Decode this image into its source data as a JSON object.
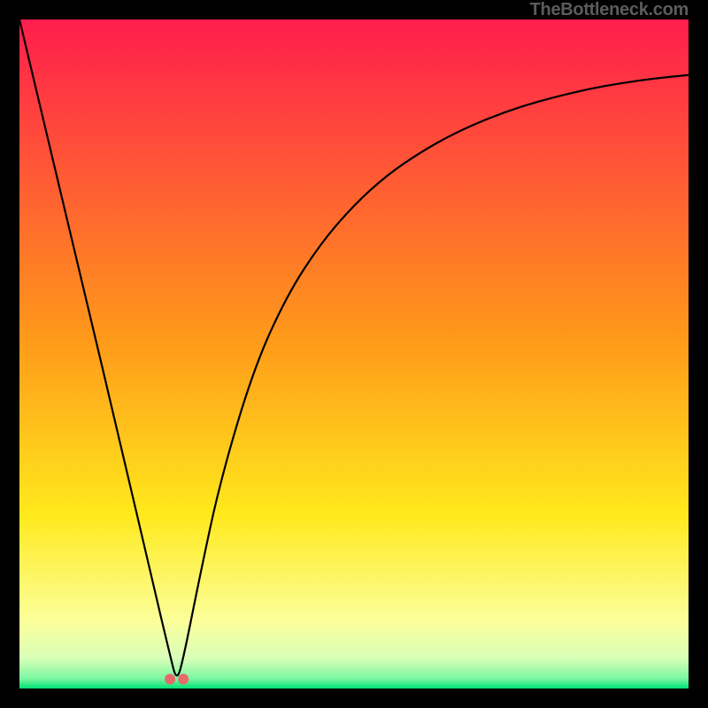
{
  "watermark": "TheBottleneck.com",
  "gradient_stops": [
    {
      "pos": 0,
      "color": "#ff1d4d"
    },
    {
      "pos": 0.48,
      "color": "#ff9a1a"
    },
    {
      "pos": 0.74,
      "color": "#ffe91c"
    },
    {
      "pos": 0.9,
      "color": "#fbff9b"
    },
    {
      "pos": 0.955,
      "color": "#d8ffb8"
    },
    {
      "pos": 0.985,
      "color": "#7cf7a2"
    },
    {
      "pos": 1.0,
      "color": "#00e076"
    }
  ],
  "curve": {
    "min_x_fraction": 0.235,
    "marker": {
      "color": "#e66a6a",
      "radius_px": 6
    }
  },
  "chart_data": {
    "type": "line",
    "title": "",
    "xlabel": "",
    "ylabel": "",
    "xlim": [
      0,
      1
    ],
    "ylim": [
      0,
      1
    ],
    "x": [
      0.0,
      0.05,
      0.1,
      0.15,
      0.2,
      0.225,
      0.235,
      0.245,
      0.27,
      0.3,
      0.35,
      0.4,
      0.45,
      0.5,
      0.55,
      0.6,
      0.65,
      0.7,
      0.75,
      0.8,
      0.85,
      0.9,
      0.95,
      1.0
    ],
    "y": [
      1.0,
      0.79,
      0.58,
      0.37,
      0.155,
      0.05,
      0.01,
      0.045,
      0.17,
      0.31,
      0.478,
      0.588,
      0.665,
      0.723,
      0.768,
      0.802,
      0.83,
      0.852,
      0.87,
      0.884,
      0.896,
      0.905,
      0.912,
      0.917
    ],
    "series": [
      {
        "name": "curve",
        "color": "#000000",
        "stroke_width_px": 2.2
      }
    ],
    "markers": [
      {
        "x": 0.225,
        "y": 0.014,
        "color": "#e66a6a"
      },
      {
        "x": 0.245,
        "y": 0.014,
        "color": "#e66a6a"
      }
    ],
    "grid": false,
    "legend": false
  }
}
